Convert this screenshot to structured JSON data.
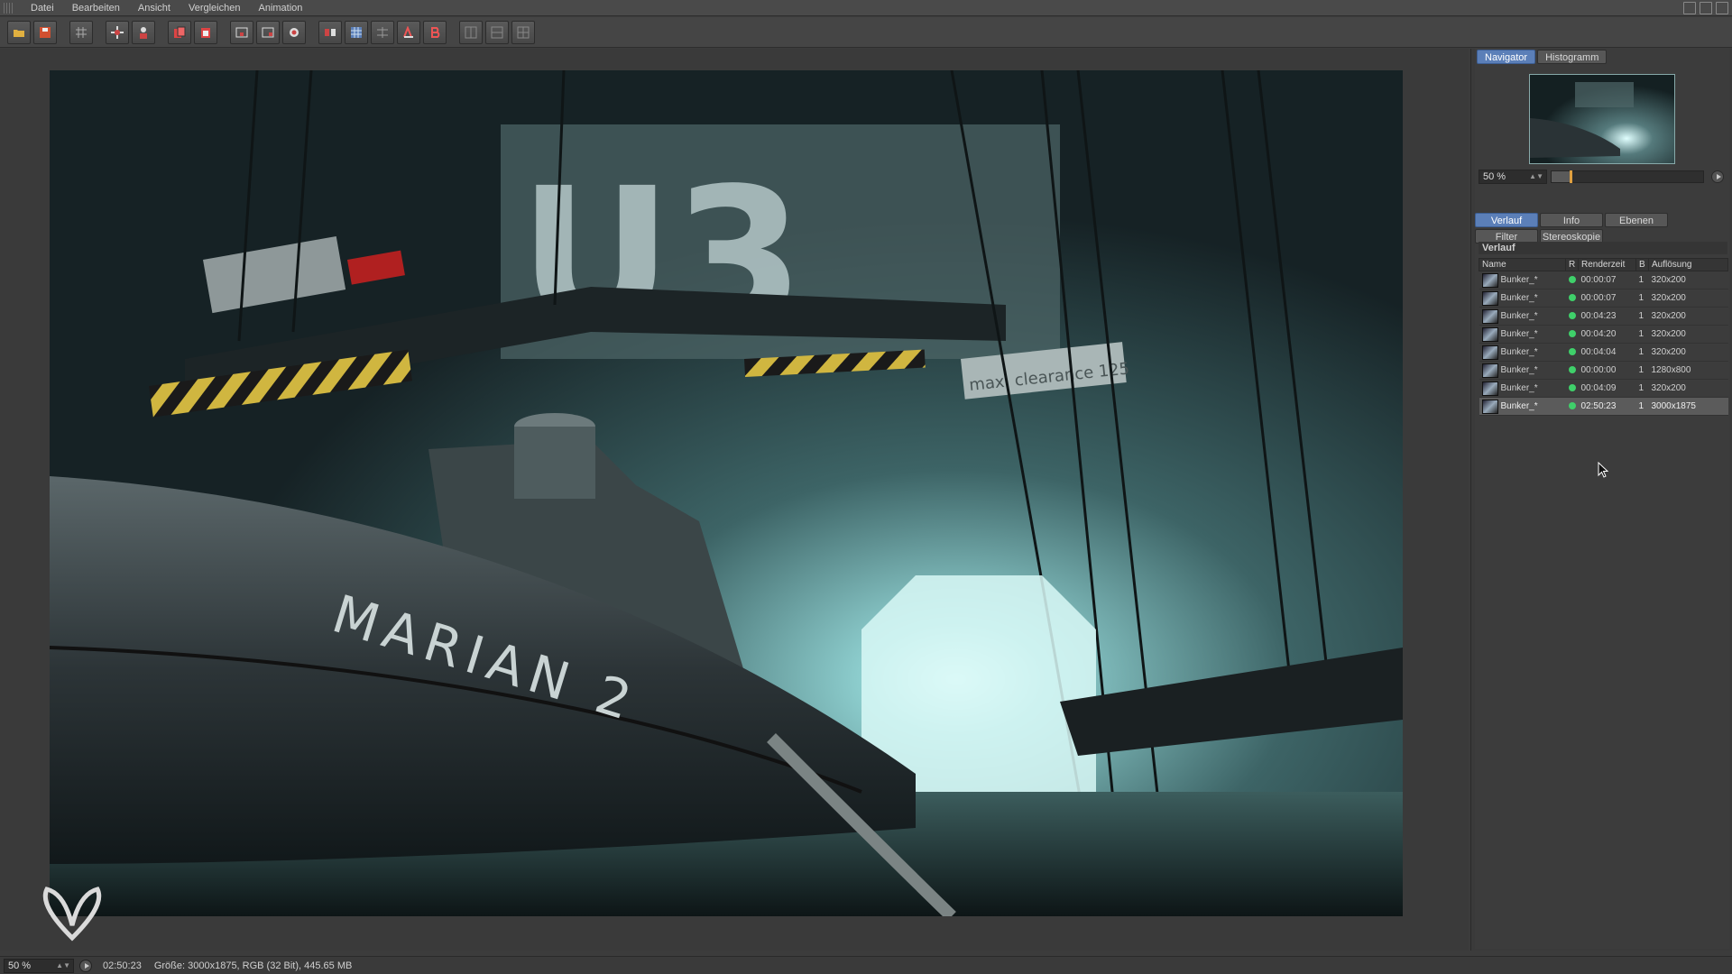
{
  "menu": [
    "Datei",
    "Bearbeiten",
    "Ansicht",
    "Vergleichen",
    "Animation"
  ],
  "toolbar": {
    "icons": [
      "open-icon",
      "save-icon",
      "grid-icon",
      "crosshair-icon",
      "person-icon",
      "copy-icon",
      "paste-icon",
      "region-render-icon",
      "region-render-2-icon",
      "camera-icon",
      "compare-ab-icon",
      "overlay-icon",
      "split-icon",
      "ab-a-icon",
      "ab-b-icon",
      "layout-1-icon",
      "layout-2-icon",
      "layout-3-icon"
    ]
  },
  "render": {
    "hull_text": "MARIAN 2",
    "banner_text": "U3",
    "sign_text": "max. clearance 125"
  },
  "panel": {
    "top_tabs": [
      "Navigator",
      "Histogramm"
    ],
    "zoom": "50 %",
    "zoom_fraction": 0.12,
    "tabs_row1": [
      "Verlauf",
      "Info",
      "Ebenen"
    ],
    "tabs_row2": [
      "Filter",
      "Stereoskopie"
    ],
    "section_title": "Verlauf",
    "columns": [
      "Name",
      "R",
      "Renderzeit",
      "B",
      "Auflösung"
    ],
    "rows": [
      {
        "name": "Bunker_*",
        "time": "00:00:07",
        "b": "1",
        "res": "320x200"
      },
      {
        "name": "Bunker_*",
        "time": "00:00:07",
        "b": "1",
        "res": "320x200"
      },
      {
        "name": "Bunker_*",
        "time": "00:04:23",
        "b": "1",
        "res": "320x200"
      },
      {
        "name": "Bunker_*",
        "time": "00:04:20",
        "b": "1",
        "res": "320x200"
      },
      {
        "name": "Bunker_*",
        "time": "00:04:04",
        "b": "1",
        "res": "320x200"
      },
      {
        "name": "Bunker_*",
        "time": "00:00:00",
        "b": "1",
        "res": "1280x800"
      },
      {
        "name": "Bunker_*",
        "time": "00:04:09",
        "b": "1",
        "res": "320x200"
      },
      {
        "name": "Bunker_*",
        "time": "02:50:23",
        "b": "1",
        "res": "3000x1875",
        "selected": true
      }
    ]
  },
  "status": {
    "zoom": "50 %",
    "time": "02:50:23",
    "info": "Größe: 3000x1875, RGB (32 Bit), 445.65 MB"
  },
  "colors": {
    "accent": "#5b7fb8",
    "status_dot": "#3fd06a",
    "slider_knob": "#e0a040"
  }
}
